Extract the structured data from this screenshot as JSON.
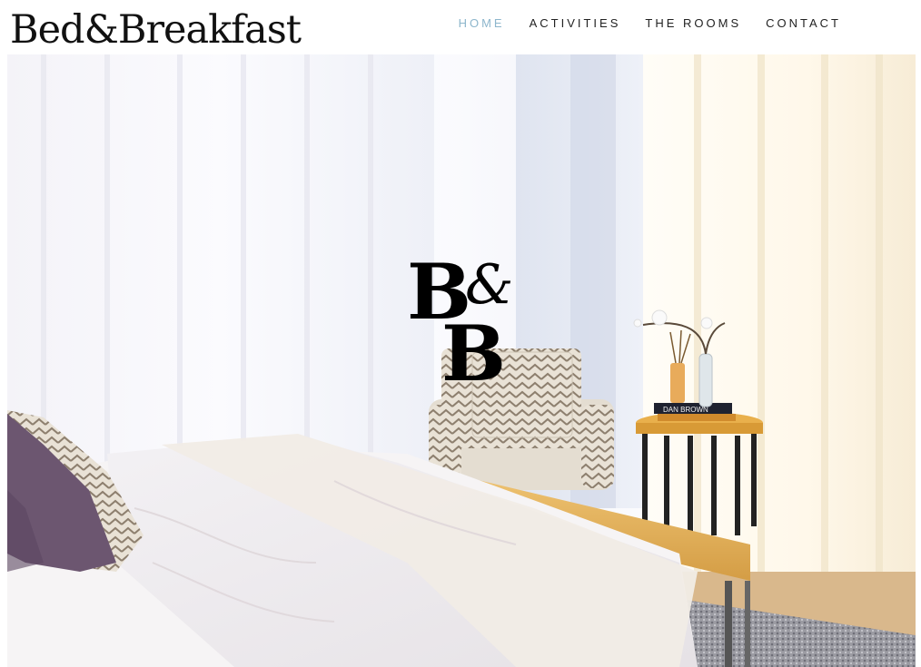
{
  "header": {
    "brand": "Bed&Breakfast"
  },
  "nav": {
    "items": [
      {
        "label": "HOME",
        "active": true
      },
      {
        "label": "ACTIVITIES",
        "active": false
      },
      {
        "label": "THE ROOMS",
        "active": false
      },
      {
        "label": "CONTACT",
        "active": false
      }
    ]
  },
  "hero": {
    "monogram": {
      "first": "B",
      "amp": "&",
      "second": "B"
    },
    "book_spine": "DAN BROWN"
  },
  "colors": {
    "nav_active": "#8db6cc",
    "nav_text": "#222222",
    "brand_text": "#111111"
  }
}
